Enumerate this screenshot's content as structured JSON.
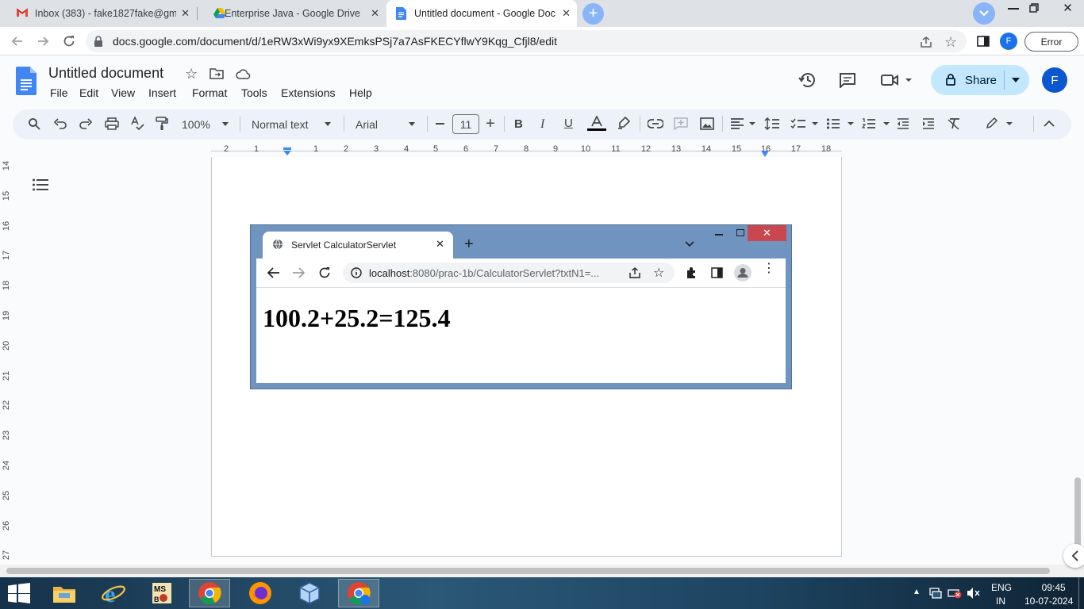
{
  "browser": {
    "tabs": [
      {
        "title": "Inbox (383) - fake1827fake@gma",
        "icon": "gmail-icon"
      },
      {
        "title": "Enterprise Java - Google Drive",
        "icon": "drive-icon"
      },
      {
        "title": "Untitled document - Google Doc",
        "icon": "docs-icon",
        "active": true
      }
    ],
    "url": "docs.google.com/document/d/1eRW3xWi9yx9XEmksPSj7a7AsFKECYflwY9Kqg_Cfjl8/edit",
    "error_label": "Error",
    "profile_initial": "F"
  },
  "docs": {
    "title": "Untitled document",
    "menu": [
      "File",
      "Edit",
      "View",
      "Insert",
      "Format",
      "Tools",
      "Extensions",
      "Help"
    ],
    "share_label": "Share",
    "account_initial": "F",
    "toolbar": {
      "zoom": "100%",
      "style": "Normal text",
      "font": "Arial",
      "font_size": "11"
    },
    "ruler_top": [
      "2",
      "1",
      "1",
      "2",
      "3",
      "4",
      "5",
      "6",
      "7",
      "8",
      "9",
      "10",
      "11",
      "12",
      "13",
      "14",
      "15",
      "16",
      "17",
      "18"
    ],
    "ruler_left": [
      "14",
      "15",
      "16",
      "17",
      "18",
      "19",
      "20",
      "21",
      "22",
      "23",
      "24",
      "25",
      "26",
      "27"
    ]
  },
  "embedded_screenshot": {
    "tab_title": "Servlet CalculatorServlet",
    "url_host": "localhost",
    "url_rest": ":8080/prac-1b/CalculatorServlet?txtN1=...",
    "result": "100.2+25.2=125.4"
  },
  "taskbar": {
    "apps": [
      "file-explorer",
      "internet-explorer",
      "msbuild-tool",
      "chrome",
      "firefox",
      "virtualbox",
      "chrome-profile"
    ],
    "lang_line1": "ENG",
    "lang_line2": "IN",
    "time": "09:45",
    "date": "10-07-2024"
  }
}
